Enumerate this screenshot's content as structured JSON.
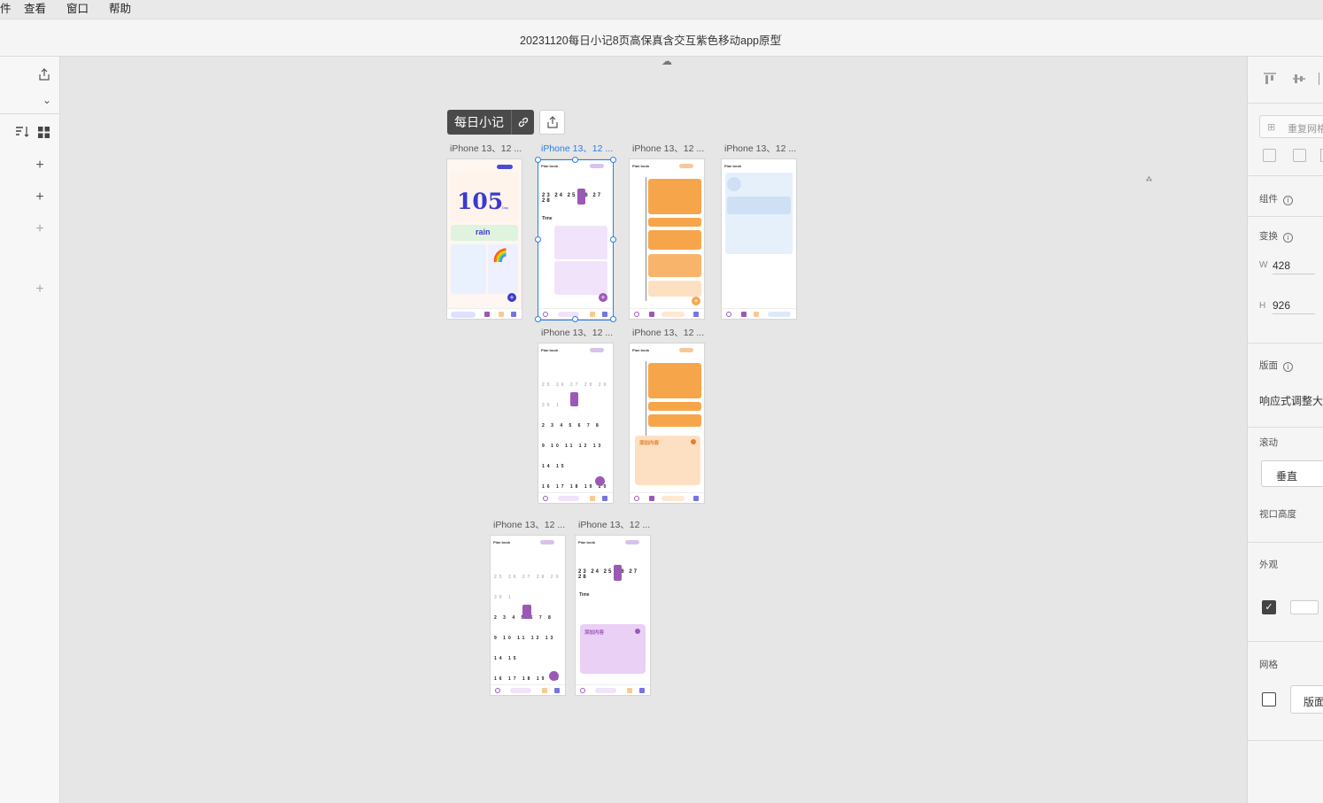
{
  "menu": {
    "items": [
      "件",
      "查看",
      "窗口",
      "帮助"
    ]
  },
  "document": {
    "title": "20231120每日小记8页高保真含交互紫色移动app原型"
  },
  "group": {
    "name": "每日小记"
  },
  "artboards": [
    {
      "label": "iPhone 13、12 ...",
      "selected": false
    },
    {
      "label": "iPhone 13、12 ...",
      "selected": true
    },
    {
      "label": "iPhone 13、12 ...",
      "selected": false
    },
    {
      "label": "iPhone 13、12 ...",
      "selected": false
    },
    {
      "label": "iPhone 13、12 ...",
      "selected": false
    },
    {
      "label": "iPhone 13、12 ...",
      "selected": false
    },
    {
      "label": "iPhone 13、12 ...",
      "selected": false
    },
    {
      "label": "iPhone 13、12 ...",
      "selected": false
    }
  ],
  "mock": {
    "plan_book": "Plan book",
    "big_number": "105",
    "day": "Day",
    "weather": "rain",
    "time_label": "Time",
    "add_content": "添加内容",
    "commemorate": "纪念日"
  },
  "right_panel": {
    "repeat_grid": "重复网格",
    "component": "组件",
    "transform": "变换",
    "w_label": "W",
    "w_value": "428",
    "h_label": "H",
    "h_value": "926",
    "layout": "版面",
    "responsive": "响应式调整大",
    "scroll": "滚动",
    "scroll_value": "垂直",
    "viewport_height": "视口高度",
    "appearance": "外观",
    "grid": "网格",
    "grid_button": "版面"
  },
  "colors": {
    "accent": "#2b7ce9",
    "purple": "#9b59b6",
    "orange": "#f7a54a",
    "light_blue": "#e6f0fb"
  }
}
